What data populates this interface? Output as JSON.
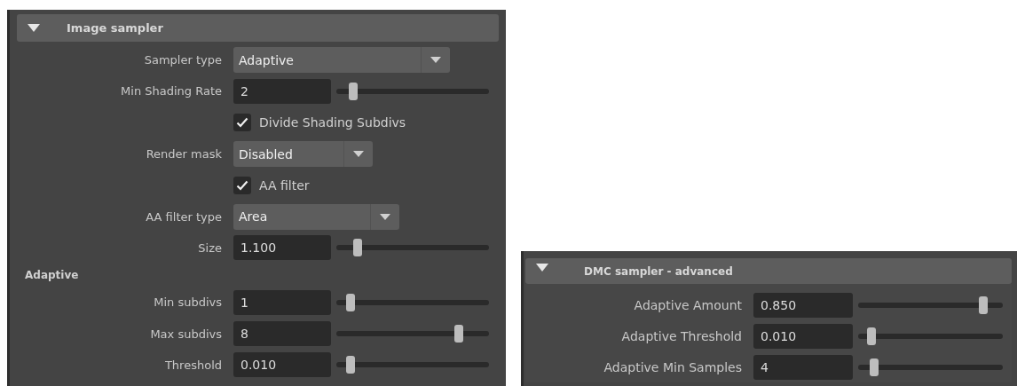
{
  "panels": [
    {
      "title": "Image sampler",
      "expanded": true,
      "rows": [
        {
          "kind": "dropdown",
          "label": "Sampler type",
          "value": "Adaptive"
        },
        {
          "kind": "slider",
          "label": "Min Shading Rate",
          "value": "2",
          "level": 0.07
        },
        {
          "kind": "checkbox",
          "label": "Divide Shading Subdivs",
          "checked": true
        },
        {
          "kind": "dropdown",
          "label": "Render mask",
          "value": "Disabled"
        },
        {
          "kind": "checkbox",
          "label": "AA filter",
          "checked": true
        },
        {
          "kind": "dropdown",
          "label": "AA filter type",
          "value": "Area"
        },
        {
          "kind": "slider",
          "label": "Size",
          "value": "1.100",
          "level": 0.1
        },
        {
          "kind": "section",
          "label": "Adaptive"
        },
        {
          "kind": "slider",
          "label": "Min subdivs",
          "value": "1",
          "level": 0.05
        },
        {
          "kind": "slider",
          "label": "Max subdivs",
          "value": "8",
          "level": 0.76
        },
        {
          "kind": "slider",
          "label": "Threshold",
          "value": "0.010",
          "level": 0.05
        }
      ]
    },
    {
      "title": "DMC sampler - advanced",
      "expanded": true,
      "rows": [
        {
          "kind": "slider",
          "label": "Adaptive Amount",
          "value": "0.850",
          "level": 0.82
        },
        {
          "kind": "slider",
          "label": "Adaptive Threshold",
          "value": "0.010",
          "level": 0.05
        },
        {
          "kind": "slider",
          "label": "Adaptive Min Samples",
          "value": "4",
          "level": 0.07
        }
      ]
    }
  ]
}
